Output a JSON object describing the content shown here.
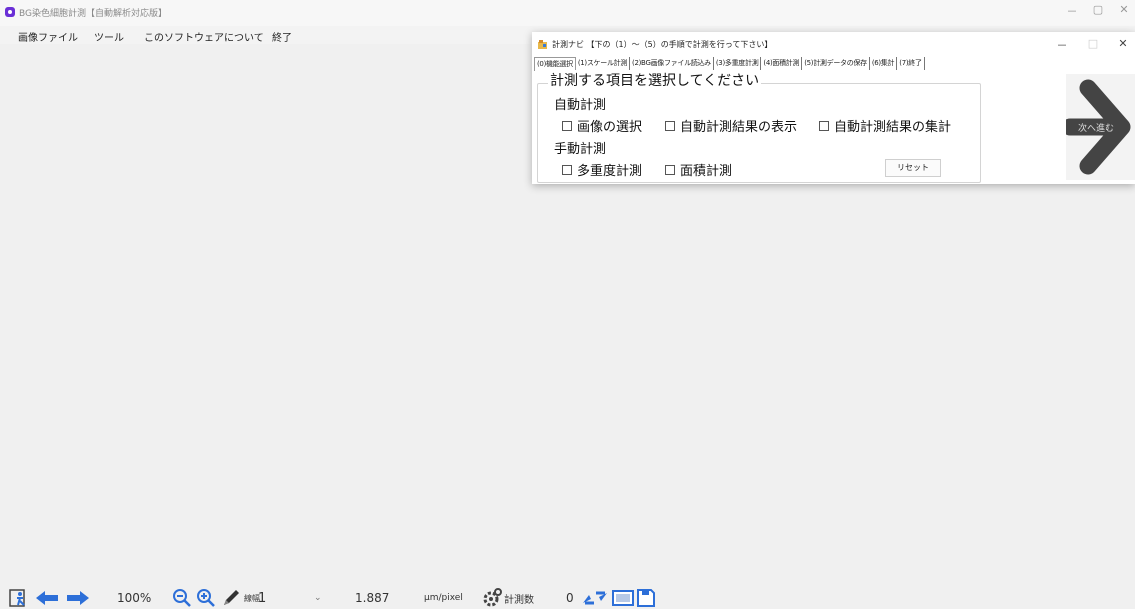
{
  "window": {
    "title": "BG染色細胞計測【自動解析対応版】",
    "controls": [
      "－",
      "▢",
      "✕"
    ]
  },
  "menu": {
    "items": [
      "画像ファイル",
      "ツール",
      "このソフトウェアについて",
      "終了"
    ]
  },
  "dialog": {
    "title": "計測ナビ 【下の（1）～（5）の手順で計測を行って下さい】",
    "controls": [
      "－",
      "□",
      "✕"
    ],
    "tabs": [
      "(0)機能選択",
      "(1)スケール計測",
      "(2)BG画像ファイル読込み",
      "(3)多重度計測",
      "(4)面積計測",
      "(5)計測データの保存",
      "(6)集計",
      "(7)終了"
    ],
    "active_tab": 0,
    "heading": "計測する項目を選択してください",
    "auto_section": "自動計測",
    "auto_options": [
      "画像の選択",
      "自動計測結果の表示",
      "自動計測結果の集計"
    ],
    "manual_section": "手動計測",
    "manual_options": [
      "多重度計測",
      "面積計測"
    ],
    "reset_label": "リセット",
    "next_label": "次へ進む"
  },
  "toolbar": {
    "zoom": "100%",
    "line_width_label": "線幅",
    "line_width_value": "1",
    "scale_value": "1.887",
    "scale_unit": "μm/pixel",
    "count_label": "計測数",
    "count_value": "0"
  },
  "colors": {
    "app_icon": "#6a2fd6",
    "arrow_blue": "#2d6fd8",
    "next_arrow": "#444444"
  }
}
